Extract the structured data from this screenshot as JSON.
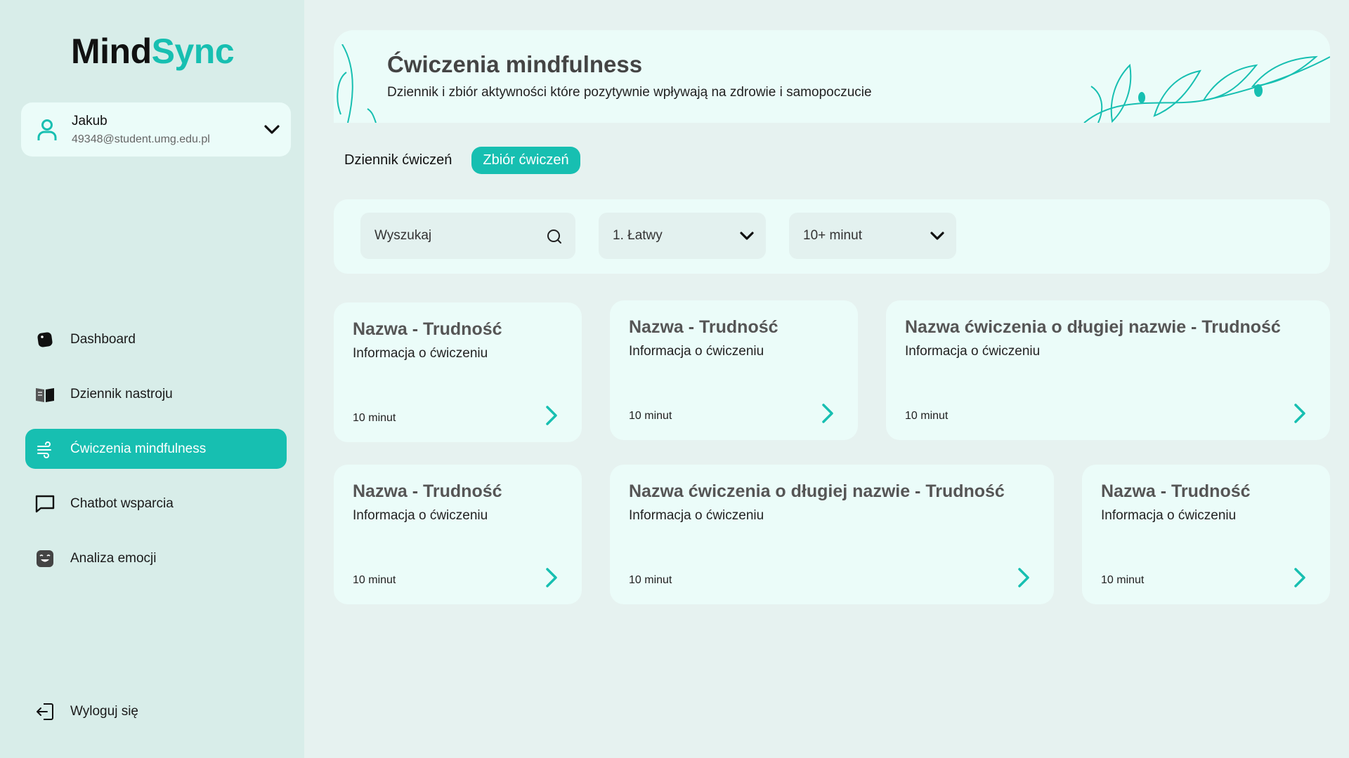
{
  "app": {
    "logo_part1": "Mind",
    "logo_part2": "Sync"
  },
  "user": {
    "name": "Jakub",
    "email": "49348@student.umg.edu.pl"
  },
  "nav": {
    "items": [
      {
        "label": "Dashboard",
        "icon": "dashboard-icon",
        "active": false
      },
      {
        "label": "Dziennik nastroju",
        "icon": "journal-icon",
        "active": false
      },
      {
        "label": "Ćwiczenia mindfulness",
        "icon": "wind-icon",
        "active": true
      },
      {
        "label": "Chatbot wsparcia",
        "icon": "chat-icon",
        "active": false
      },
      {
        "label": "Analiza emocji",
        "icon": "emotion-icon",
        "active": false
      }
    ],
    "logout_label": "Wyloguj się"
  },
  "header": {
    "title": "Ćwiczenia mindfulness",
    "subtitle": "Dziennik i zbiór aktywności które pozytywnie wpływają na zdrowie i samopoczucie"
  },
  "tabs": [
    {
      "label": "Dziennik ćwiczeń",
      "active": false
    },
    {
      "label": "Zbiór ćwiczeń",
      "active": true
    }
  ],
  "filters": {
    "search_placeholder": "Wyszukaj",
    "difficulty_value": "1. Łatwy",
    "duration_value": "10+ minut"
  },
  "cards": [
    {
      "title": "Nazwa - Trudność",
      "info": "Informacja o ćwiczeniu",
      "time": "10 minut"
    },
    {
      "title": "Nazwa - Trudność",
      "info": "Informacja o ćwiczeniu",
      "time": "10 minut"
    },
    {
      "title": "Nazwa ćwiczenia o długiej nazwie - Trudność",
      "info": "Informacja o ćwiczeniu",
      "time": "10 minut"
    },
    {
      "title": "Nazwa - Trudność",
      "info": "Informacja o ćwiczeniu",
      "time": "10 minut"
    },
    {
      "title": "Nazwa ćwiczenia o długiej nazwie - Trudność",
      "info": "Informacja o ćwiczeniu",
      "time": "10 minut"
    },
    {
      "title": "Nazwa - Trudność",
      "info": "Informacja o ćwiczeniu",
      "time": "10 minut"
    }
  ],
  "colors": {
    "accent": "#17bfb1",
    "sidebar_bg": "#d8ede9",
    "card_bg": "#ebfcf9",
    "page_bg": "#e6f2f0"
  }
}
